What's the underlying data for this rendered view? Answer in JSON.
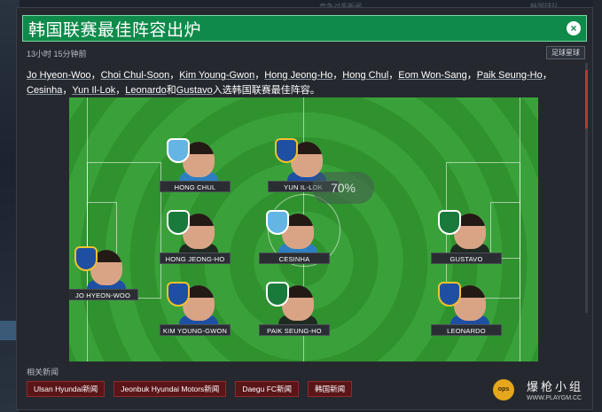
{
  "background": {
    "ghost_text_top": "竞争对手新闻",
    "ghost_text_top_right": "韩国球队"
  },
  "modal": {
    "title": "韩国联赛最佳阵容出炉",
    "close_icon": "×",
    "timestamp": "13小时 15分钟前",
    "follow_button": "足球星球",
    "body_names": [
      "Jo Hyeon-Woo",
      "Choi Chul-Soon",
      "Kim Young-Gwon",
      "Hong Jeong-Ho",
      "Hong Chul",
      "Eom Won-Sang",
      "Paik Seung-Ho",
      "Cesinha",
      "Yun Il-Lok",
      "Leonardo",
      "Gustavo"
    ],
    "body_sep": "，",
    "body_and": "和",
    "body_suffix": "入选韩国联赛最佳阵容。"
  },
  "pitch": {
    "match_badge": "70%",
    "players": [
      {
        "name": "HONG CHUL",
        "club": "daegu"
      },
      {
        "name": "YUN IL-LOK",
        "club": "ulsan"
      },
      {
        "name": "HONG JEONG-HO",
        "club": "jeonbuk"
      },
      {
        "name": "CESINHA",
        "club": "daegu"
      },
      {
        "name": "GUSTAVO",
        "club": "jeonbuk"
      },
      {
        "name": "JO HYEON-WOO",
        "club": "ulsan"
      },
      {
        "name": "KIM YOUNG-GWON",
        "club": "ulsan"
      },
      {
        "name": "PAIK SEUNG-HO",
        "club": "jeonbuk"
      },
      {
        "name": "LEONARDO",
        "club": "ulsan"
      }
    ]
  },
  "related": {
    "label": "相关新闻",
    "tags": [
      "Ulsan Hyundai新闻",
      "Jeonbuk Hyundai Motors新闻",
      "Daegu FC新闻",
      "韩国新闻"
    ]
  },
  "watermark": {
    "icon_text": "ops",
    "title": "爆枪小组",
    "url": "WWW.PLAYGM.CC"
  },
  "colors": {
    "title_green": "#0f8a4a",
    "tag_red": "#5a1518",
    "pitch_green": "#3aa13a",
    "scroll_accent": "#b43838"
  }
}
